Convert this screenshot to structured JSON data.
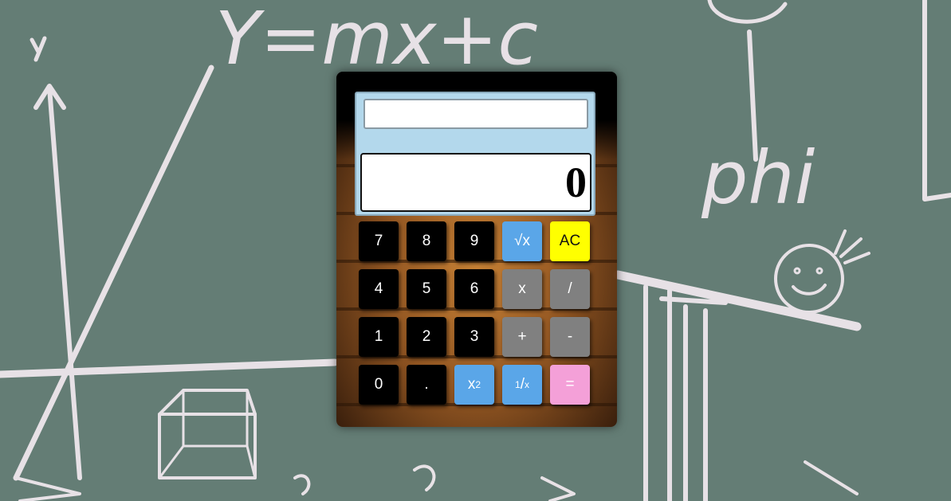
{
  "calculator": {
    "expression_value": "",
    "result_value": "0",
    "keys": {
      "k7": "7",
      "k8": "8",
      "k9": "9",
      "sqrt": "√x",
      "ac": "AC",
      "k4": "4",
      "k5": "5",
      "k6": "6",
      "mul": "x",
      "div": "/",
      "k1": "1",
      "k2": "2",
      "k3": "3",
      "add": "+",
      "sub": "-",
      "k0": "0",
      "dot": ".",
      "square_base": "x",
      "square_exp": "2",
      "recip_num": "1",
      "recip_den": "x",
      "equals": "="
    }
  },
  "background": {
    "chalk_text": {
      "formula": "Y=mx+c",
      "phi": "phi",
      "y_axis": "y"
    }
  },
  "colors": {
    "board": "#647d75",
    "screen": "#b3d8ec",
    "key_dark": "#000000",
    "key_blue": "#5aa6e8",
    "key_yellow": "#ffff00",
    "key_grey": "#808080",
    "key_pink": "#f4a0d8"
  }
}
